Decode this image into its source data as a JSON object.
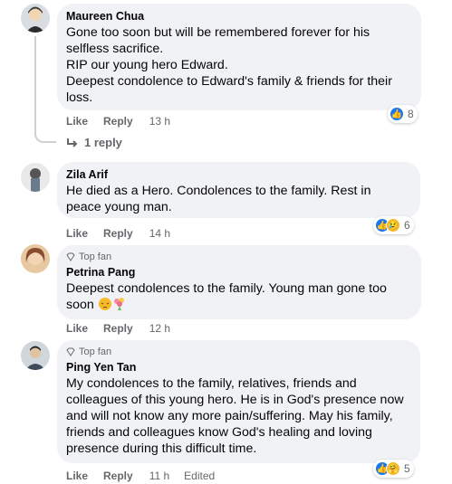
{
  "comments": [
    {
      "author": "Maureen Chua",
      "top_fan": "",
      "lines": [
        "Gone too soon but will be remembered forever for his selfless sacrifice.",
        "RIP our young hero Edward.",
        "Deepest condolence to Edward's family & friends for their loss."
      ],
      "like": "Like",
      "reply": "Reply",
      "time": "13 h",
      "reactions": [
        "like-icon"
      ],
      "reaction_count": "8",
      "replies_label": "1 reply"
    },
    {
      "author": "Zila Arif",
      "top_fan": "",
      "lines": [
        "He died as a Hero. Condolences to the family. Rest in peace young man."
      ],
      "like": "Like",
      "reply": "Reply",
      "time": "14 h",
      "reactions": [
        "like-icon",
        "sad-icon"
      ],
      "reaction_count": "6"
    },
    {
      "author": "Petrina Pang",
      "top_fan": "Top fan",
      "lines": [
        "Deepest condolences to the family. Young man gone too soon"
      ],
      "emojis": [
        "pensive-face-icon",
        "bouquet-icon"
      ],
      "like": "Like",
      "reply": "Reply",
      "time": "12 h"
    },
    {
      "author": "Ping Yen Tan",
      "top_fan": "Top fan",
      "lines": [
        "My condolences to the family, relatives, friends and colleagues of this young hero. He is in God's presence now and will not know any more pain/suffering. May his family, friends and colleagues know God's healing and loving presence during this difficult time."
      ],
      "like": "Like",
      "reply": "Reply",
      "time": "11 h",
      "edited": "Edited",
      "reactions": [
        "like-icon",
        "care-icon"
      ],
      "reaction_count": "5"
    }
  ],
  "colors": {
    "bubble": "#f0f2f5",
    "like_blue": "#1877f2",
    "meta": "#65676b"
  }
}
